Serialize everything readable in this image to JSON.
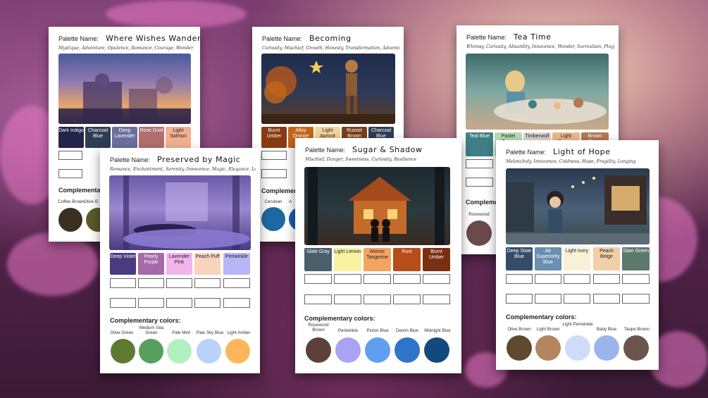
{
  "palette_label": "Palette Name:",
  "complementary_label": "Complementary colors:",
  "complementary_truncated": "Complementary",
  "cards": {
    "where": {
      "name": "Where Wishes Wander",
      "tags": "Mystique, Adventure, Opulence, Romance, Courage, Wonder",
      "swatches": [
        {
          "label": "Dark Indigo",
          "color": "#22244a"
        },
        {
          "label": "Charcoal Blue",
          "color": "#2e3d55"
        },
        {
          "label": "Deep Lavender",
          "color": "#6a6f9c"
        },
        {
          "label": "Rose Gold",
          "color": "#b06f6c"
        },
        {
          "label": "Light Salmon",
          "color": "#f2b08f"
        }
      ],
      "comps": [
        {
          "label": "Coffee Brown",
          "color": "#3b2f22"
        },
        {
          "label": "Olive B",
          "color": "#5b5a2a"
        }
      ]
    },
    "becoming": {
      "name": "Becoming",
      "tags": "Curiosity, Mischief, Growth, Honesty, Transformation, Adventure",
      "swatches": [
        {
          "label": "Burnt Umber",
          "color": "#8a3a12"
        },
        {
          "label": "Alloy Orange",
          "color": "#c4661a"
        },
        {
          "label": "Light Apricot",
          "color": "#f6d39a"
        },
        {
          "label": "Russet Brown",
          "color": "#7b3f1b"
        },
        {
          "label": "Charcoal Blue",
          "color": "#2e3d55"
        }
      ],
      "comps": [
        {
          "label": "Cerulean",
          "color": "#1d6aa3"
        },
        {
          "label": "A",
          "color": "#1c5fa8"
        }
      ]
    },
    "tea": {
      "name": "Tea Time",
      "tags": "Whimsy, Curiosity, Absurdity, Innocence, Wonder, Surrealism, Playfulness",
      "swatches": [
        {
          "label": "Teal Blue",
          "color": "#3f7f85"
        },
        {
          "label": "Pastel Green",
          "color": "#b9dcb5"
        },
        {
          "label": "Timberwolf",
          "color": "#dcd6cf"
        },
        {
          "label": "Light Copper",
          "color": "#eab98c"
        },
        {
          "label": "Brown Sugar",
          "color": "#b07a53"
        }
      ],
      "comps": [
        {
          "label": "Rosewood",
          "color": "#6b4a4c"
        }
      ]
    },
    "magic": {
      "name": "Preserved by Magic",
      "tags": "Romance, Enchantment, Serenity, Innocence, Magic, Elegance, Longing",
      "swatches": [
        {
          "label": "Deep Violet",
          "color": "#4a3a80"
        },
        {
          "label": "Pearly Purple",
          "color": "#a56aa8"
        },
        {
          "label": "Lavender Pink",
          "color": "#f0b5ea"
        },
        {
          "label": "Peach Puff",
          "color": "#f8d4bd"
        },
        {
          "label": "Periwinkle",
          "color": "#b9b6f5"
        }
      ],
      "comps": [
        {
          "label": "Olive Green",
          "color": "#5e7a32"
        },
        {
          "label": "Medium Sea Green",
          "color": "#55a05e"
        },
        {
          "label": "Pale Mint",
          "color": "#b3f0c0"
        },
        {
          "label": "Pale Sky Blue",
          "color": "#b8d2f8"
        },
        {
          "label": "Light Amber",
          "color": "#ffb65a"
        }
      ]
    },
    "sugar": {
      "name": "Sugar & Shadow",
      "tags": "Mischief, Danger, Sweetness, Curiosity, Resilience",
      "swatches": [
        {
          "label": "Slate Gray",
          "color": "#4a5f6b"
        },
        {
          "label": "Light Lemon",
          "color": "#f9f2a0"
        },
        {
          "label": "Atomic Tangerine",
          "color": "#f4a461"
        },
        {
          "label": "Rust",
          "color": "#b74d1b"
        },
        {
          "label": "Burnt Umber",
          "color": "#7a2f12"
        }
      ],
      "comps": [
        {
          "label": "Rosewood Brown",
          "color": "#5c4039"
        },
        {
          "label": "Periwinkle",
          "color": "#a9a2f5"
        },
        {
          "label": "Picton Blue",
          "color": "#5e9ff2"
        },
        {
          "label": "Denim Blue",
          "color": "#2f74c8"
        },
        {
          "label": "Midnight Blue",
          "color": "#124a7e"
        }
      ]
    },
    "hope": {
      "name": "Light of Hope",
      "tags": "Melancholy, Innocence, Coldness, Hope, Fragility, Longing",
      "swatches": [
        {
          "label": "Deep Slate Blue",
          "color": "#344d66"
        },
        {
          "label": "Air Superiority Blue",
          "color": "#6a8fb0"
        },
        {
          "label": "Light Ivory",
          "color": "#f8f1d8"
        },
        {
          "label": "Peach Beige",
          "color": "#f1cfa8"
        },
        {
          "label": "Slate Green",
          "color": "#5b7a6c"
        }
      ],
      "comps": [
        {
          "label": "Olive Brown",
          "color": "#5f4a2f"
        },
        {
          "label": "Light Brown",
          "color": "#b38660"
        },
        {
          "label": "Light Periwinkle",
          "color": "#cfdcf8"
        },
        {
          "label": "Baby Blue",
          "color": "#9ab5ec"
        },
        {
          "label": "Taupe Brown",
          "color": "#6a564c"
        }
      ]
    }
  }
}
